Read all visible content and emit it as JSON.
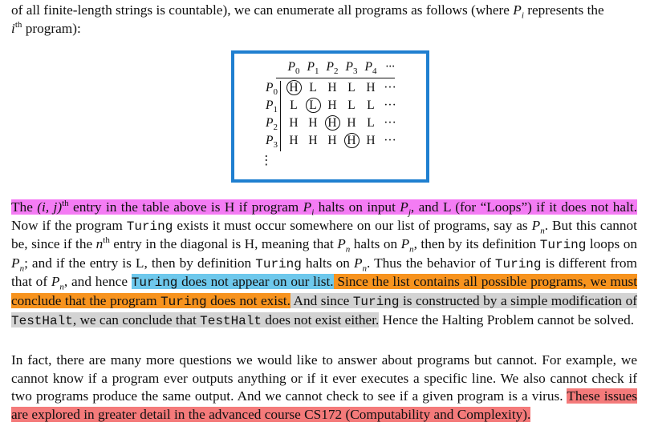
{
  "intro": {
    "line1": "of all finite-length strings is countable), we can enumerate all programs as follows (where ",
    "p_i": "P",
    "p_i_sub": "i",
    "line1_end": " represents the",
    "sup": "th",
    "line2_pre": "i",
    "line2": " program):"
  },
  "table": {
    "col_labels": [
      "P0",
      "P1",
      "P2",
      "P3",
      "P4",
      "···"
    ],
    "rows": [
      {
        "label": "P0",
        "cells": [
          "H",
          "L",
          "H",
          "L",
          "H",
          "···"
        ],
        "circled": 0
      },
      {
        "label": "P1",
        "cells": [
          "L",
          "L",
          "H",
          "L",
          "L",
          "···"
        ],
        "circled": 1
      },
      {
        "label": "P2",
        "cells": [
          "H",
          "H",
          "H",
          "H",
          "L",
          "···"
        ],
        "circled": 2
      },
      {
        "label": "P3",
        "cells": [
          "H",
          "H",
          "H",
          "H",
          "H",
          "···"
        ],
        "circled": 3
      }
    ],
    "vdots": "⋮"
  },
  "para1": {
    "s1a": "The ",
    "s1b": "(i, j)",
    "s1c": "th",
    "s1d": " entry in the table above is H if program ",
    "s1e": "P",
    "s1f": "i",
    "s1g": " halts on input ",
    "s1h": "P",
    "s1i": "j",
    "s1j": ", and L (for “Loops”) if it does not halt.",
    "s2a": " Now if the program ",
    "turing": "Turing",
    "s2b": " exists it must occur somewhere on our list of programs, say as ",
    "pn": "P",
    "n": "n",
    "s2c": ". But this cannot be, since if the ",
    "nth": "n",
    "th": "th",
    "s2d": " entry in the diagonal is H, meaning that ",
    "s2e": " halts on ",
    "s2f": ", then by its definition ",
    "s2g": " loops on ",
    "s2h": "; and if the entry is L, then by definition ",
    "s2i": " halts on ",
    "s2j": ". Thus the behavior of ",
    "s2k": " is different from that of ",
    "s2l": ", and hence ",
    "s3": " does not appear on our list.",
    "s4": " Since the list contains all possible programs, we must conclude that the program ",
    "s4b": " does not exist.",
    "s5a": " And since ",
    "s5b": " is constructed by a simple modification of ",
    "testhalt": "TestHalt",
    "s5c": ", we can conclude that ",
    "s5d": " does not exist either.",
    "s6": " Hence the Halting Problem cannot be solved."
  },
  "para2": {
    "text": "In fact, there are many more questions we would like to answer about programs but cannot. For example, we cannot know if a program ever outputs anything or if it ever executes a specific line. We also cannot check if two programs produce the same output. And we cannot check to see if a given program is a virus. ",
    "highlight": "These issues are explored in greater detail in the advanced course CS172 (Computability and Complexity)."
  }
}
